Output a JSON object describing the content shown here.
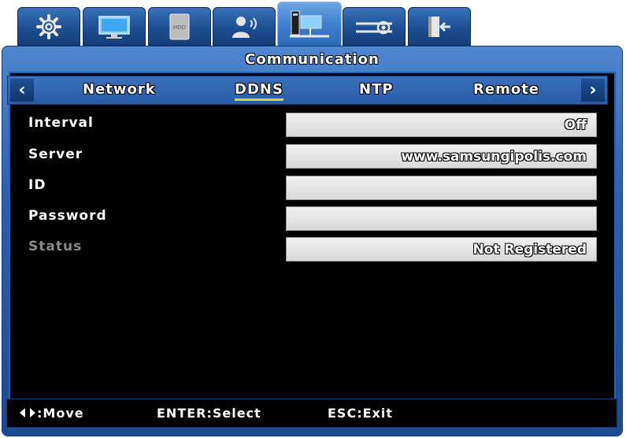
{
  "tabs": [
    {
      "icon": "gear-icon"
    },
    {
      "icon": "monitor-icon"
    },
    {
      "icon": "hdd-icon",
      "label": "HDD"
    },
    {
      "icon": "user-icon"
    },
    {
      "icon": "network-icon"
    },
    {
      "icon": "slider-settings-icon"
    },
    {
      "icon": "exit-door-icon"
    }
  ],
  "active_tab_index": 4,
  "title": "Communication",
  "subtabs": {
    "prev_arrow": "‹",
    "next_arrow": "›",
    "items": [
      "Network",
      "DDNS",
      "NTP",
      "Remote"
    ],
    "active": "DDNS"
  },
  "rows": [
    {
      "label": "Interval",
      "value": "Off",
      "enabled": true
    },
    {
      "label": "Server",
      "value": "www.samsungipolis.com",
      "enabled": true
    },
    {
      "label": "ID",
      "value": "",
      "enabled": true
    },
    {
      "label": "Password",
      "value": "",
      "enabled": true
    },
    {
      "label": "Status",
      "value": "Not Registered",
      "enabled": false
    }
  ],
  "statusbar": {
    "move": ":Move",
    "select": "ENTER:Select",
    "exit": "ESC:Exit"
  },
  "colors": {
    "panel_blue": "#2a5fae",
    "active_underline": "#e2d23a",
    "disabled_text": "#8a8a8a"
  }
}
